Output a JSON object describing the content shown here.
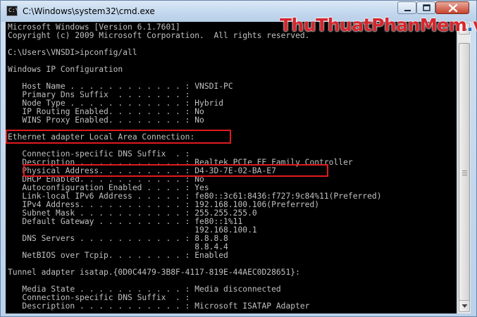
{
  "window": {
    "title": "C:\\Windows\\system32\\cmd.exe",
    "icon": "cmd-icon",
    "icon_text": "C:\\"
  },
  "watermark": {
    "part1": "ThuThuatPhanMem",
    "dot": ".",
    "part2": "vn"
  },
  "controls": {
    "minimize": "minimize-icon",
    "maximize": "maximize-icon",
    "close": "close-icon"
  },
  "console": {
    "lines": [
      "Microsoft Windows [Version 6.1.7601]",
      "Copyright (c) 2009 Microsoft Corporation.  All rights reserved.",
      "",
      "C:\\Users\\VNSDI>ipconfig/all",
      "",
      "Windows IP Configuration",
      "",
      "   Host Name . . . . . . . . . . . . : VNSDI-PC",
      "   Primary Dns Suffix  . . . . . . . :",
      "   Node Type . . . . . . . . . . . . : Hybrid",
      "   IP Routing Enabled. . . . . . . . : No",
      "   WINS Proxy Enabled. . . . . . . . : No",
      "",
      "Ethernet adapter Local Area Connection:",
      "",
      "   Connection-specific DNS Suffix  . :",
      "   Description . . . . . . . . . . . : Realtek PCIe FE Family Controller",
      "   Physical Address. . . . . . . . . : D4-3D-7E-02-BA-E7",
      "   DHCP Enabled. . . . . . . . . . . : No",
      "   Autoconfiguration Enabled . . . . : Yes",
      "   Link-local IPv6 Address . . . . . : fe80::3c61:8436:f727:9c84%11(Preferred)",
      "   IPv4 Address. . . . . . . . . . . : 192.168.100.106(Preferred)",
      "   Subnet Mask . . . . . . . . . . . : 255.255.255.0",
      "   Default Gateway . . . . . . . . . : fe80::1%11",
      "                                       192.168.100.1",
      "   DNS Servers . . . . . . . . . . . : 8.8.8.8",
      "                                       8.8.4.4",
      "   NetBIOS over Tcpip. . . . . . . . : Enabled",
      "",
      "Tunnel adapter isatap.{0D0C4479-3B8F-4117-819E-44AEC0D28651}:",
      "",
      "   Media State . . . . . . . . . . . : Media disconnected",
      "   Connection-specific DNS Suffix  . :",
      "   Description . . . . . . . . . . . : Microsoft ISATAP Adapter"
    ]
  },
  "colors": {
    "console_bg": "#000000",
    "console_text": "#c0c0c0",
    "highlight": "#e0191e"
  }
}
